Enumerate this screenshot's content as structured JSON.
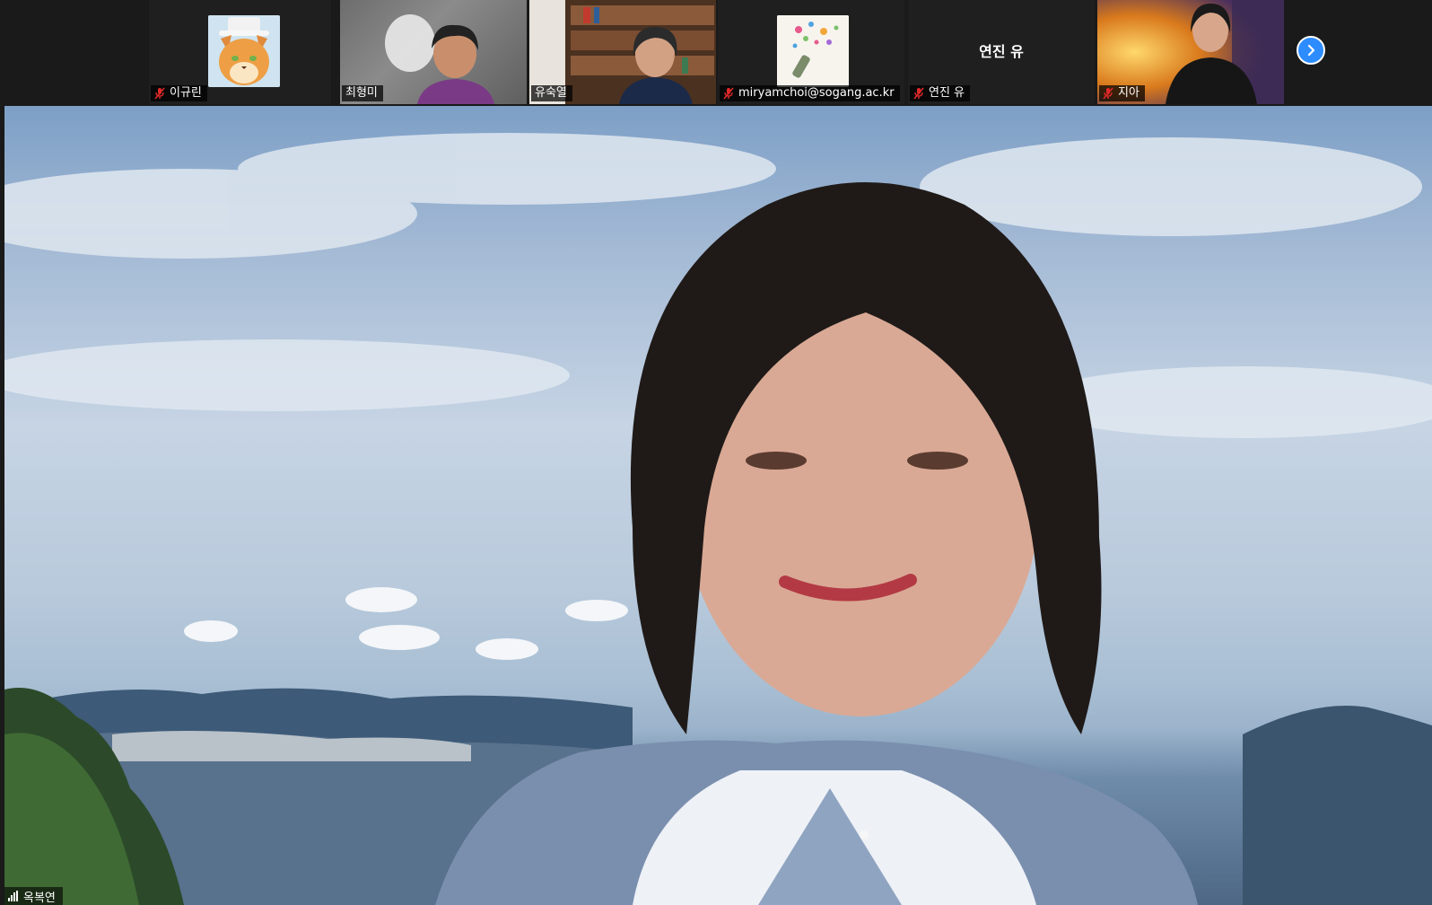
{
  "participants": [
    {
      "name": "이규린",
      "muted": true,
      "display": "avatar",
      "avatar": "cat-gentleman-avatar"
    },
    {
      "name": "최형미",
      "muted": false,
      "display": "video"
    },
    {
      "name": "유숙열",
      "muted": false,
      "display": "video"
    },
    {
      "name": "miryamchoi@sogang.ac.kr",
      "muted": true,
      "display": "avatar",
      "avatar": "champagne-celebration-avatar"
    },
    {
      "name": "연진 유",
      "muted": true,
      "display": "name-only",
      "center_name": "연진 유"
    },
    {
      "name": "지아",
      "muted": true,
      "display": "video"
    }
  ],
  "strip": {
    "next_icon": "chevron-right-icon"
  },
  "active_speaker": {
    "name": "옥복연",
    "signal_icon": "signal-bars-icon"
  },
  "colors": {
    "mute_red": "#e02828",
    "next_button": "#2d8cff",
    "strip_bg": "#1a1a1a"
  }
}
